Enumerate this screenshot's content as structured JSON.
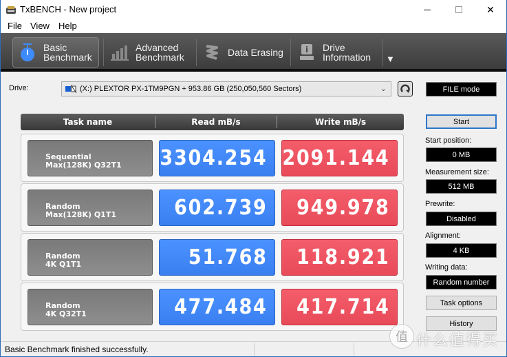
{
  "window": {
    "title": "TxBENCH - New project",
    "controls": {
      "minimize": "—",
      "maximize": "☐",
      "close": "✕"
    }
  },
  "menu": [
    "File",
    "View",
    "Help"
  ],
  "toolbar": {
    "tabs": [
      {
        "line1": "Basic",
        "line2": "Benchmark",
        "icon": "stopwatch-icon",
        "active": true
      },
      {
        "line1": "Advanced",
        "line2": "Benchmark",
        "icon": "bar-chart-icon",
        "active": false
      },
      {
        "line1": "Data Erasing",
        "line2": "",
        "icon": "eraser-icon",
        "active": false
      },
      {
        "line1": "Drive",
        "line2": "Information",
        "icon": "drive-info-icon",
        "active": false
      }
    ],
    "more": "▼"
  },
  "drive": {
    "label": "Drive:",
    "selected": "(X:) PLEXTOR PX-1TM9PGN + 953.86 GB (250,050,560 Sectors)",
    "mode": "FILE mode"
  },
  "table": {
    "headers": [
      "Task name",
      "Read mB/s",
      "Write mB/s"
    ],
    "rows": [
      {
        "line1": "Sequential",
        "line2": "Max(128K) Q32T1",
        "read": "3304.254",
        "write": "2091.144"
      },
      {
        "line1": "Random",
        "line2": "Max(128K) Q1T1",
        "read": "602.739",
        "write": "949.978"
      },
      {
        "line1": "Random",
        "line2": "4K Q1T1",
        "read": "51.768",
        "write": "118.921"
      },
      {
        "line1": "Random",
        "line2": "4K Q32T1",
        "read": "477.484",
        "write": "417.714"
      }
    ]
  },
  "side": {
    "start": "Start",
    "start_position_label": "Start position:",
    "start_position": "0 MB",
    "measurement_size_label": "Measurement size:",
    "measurement_size": "512 MB",
    "prewrite_label": "Prewrite:",
    "prewrite": "Disabled",
    "alignment_label": "Alignment:",
    "alignment": "4 KB",
    "writing_data_label": "Writing data:",
    "writing_data": "Random number",
    "task_options": "Task options",
    "history": "History"
  },
  "status": "Basic Benchmark finished successfully.",
  "watermark": {
    "glyph": "值",
    "text": "什么值得买"
  }
}
